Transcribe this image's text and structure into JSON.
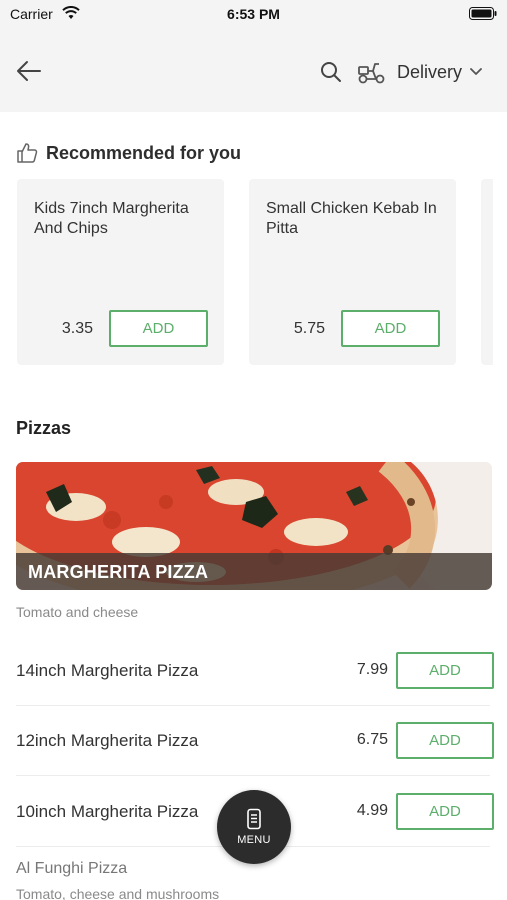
{
  "status_bar": {
    "carrier": "Carrier",
    "time": "6:53 PM"
  },
  "header": {
    "delivery_label": "Delivery"
  },
  "recommended": {
    "title": "Recommended for you",
    "items": [
      {
        "name": "Kids 7inch Margherita And Chips",
        "price": "3.35",
        "add_label": "ADD"
      },
      {
        "name": "Small Chicken Kebab In Pitta",
        "price": "5.75",
        "add_label": "ADD"
      }
    ]
  },
  "section": {
    "title": "Pizzas",
    "banner_label": "MARGHERITA PIZZA",
    "description": "Tomato and cheese",
    "items": [
      {
        "name": "14inch Margherita Pizza",
        "price": "7.99",
        "add_label": "ADD"
      },
      {
        "name": "12inch Margherita Pizza",
        "price": "6.75",
        "add_label": "ADD"
      },
      {
        "name": "10inch Margherita Pizza",
        "price": "4.99",
        "add_label": "ADD"
      }
    ],
    "next_item": "Al Funghi Pizza",
    "next_description": "Tomato, cheese and mushrooms"
  },
  "fab": {
    "label": "MENU"
  },
  "colors": {
    "accent": "#5cae6b",
    "header_bg": "#f4f4f4",
    "fab_bg": "#2c2c2c"
  },
  "icons": [
    "wifi-icon",
    "battery-icon",
    "back-arrow-icon",
    "search-icon",
    "scooter-icon",
    "chevron-down-icon",
    "thumbs-up-icon",
    "menu-icon"
  ]
}
